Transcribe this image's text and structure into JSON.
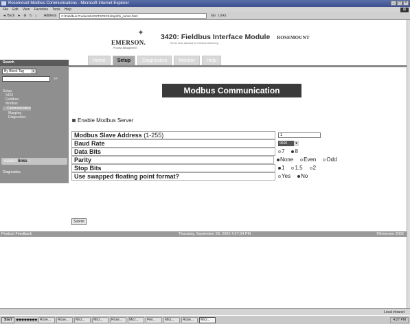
{
  "window": {
    "title": "Rosemount Modbus Communications - Microsoft Internet Explorer",
    "menus": [
      "File",
      "Edit",
      "View",
      "Favorites",
      "Tools",
      "Help"
    ]
  },
  "toolbar": {
    "back": "Back",
    "address_label": "Address",
    "address": "C:\\Fieldbus Products\\HOSTSPEC\\Hlmp\\fcb_comm.html",
    "go": "Go",
    "links": "Links"
  },
  "header": {
    "logo_text": "EMERSON.",
    "logo_sub": "Process Management",
    "app_title": "3420: Fieldbus Interface Module",
    "app_subtitle": "The Air facto standard for Fieldbus Monitoring",
    "brand": "ROSEMOUNT"
  },
  "tabs": [
    {
      "label": "Home"
    },
    {
      "label": "Setup",
      "active": true
    },
    {
      "label": "Diagnostics"
    },
    {
      "label": "Monitor"
    },
    {
      "label": "Help"
    }
  ],
  "sidebar": {
    "search_label": "Search",
    "search_type": "By Block Tag",
    "go": ">>",
    "nav": {
      "setup": "Setup",
      "model": "3420",
      "fieldbus": "Fieldbus",
      "modbus": "Modbus",
      "communication": "Communication",
      "mapping": "Mapping",
      "diagnostics": "Diagnostics"
    },
    "related_prefix": "related",
    "related_links": "links",
    "diagnostics_link": "Diagnostics"
  },
  "main": {
    "title": "Modbus Communication",
    "enable_label": "Enable Modbus Server",
    "enable_checked": true,
    "slave_address_label": "Modbus Slave Address",
    "slave_address_range": "(1-255)",
    "slave_address_value": "1",
    "baud_rate_label": "Baud Rate",
    "baud_rate_value": "9600",
    "data_bits_label": "Data Bits",
    "data_bits_options": [
      "7",
      "8"
    ],
    "data_bits_selected": "8",
    "parity_label": "Parity",
    "parity_options": [
      "None",
      "Even",
      "Odd"
    ],
    "parity_selected": "None",
    "stop_bits_label": "Stop Bits",
    "stop_bits_options": [
      "1",
      "1.5",
      "2"
    ],
    "stop_bits_selected": "1",
    "swapped_label": "Use swapped floating point format?",
    "swapped_options": [
      "Yes",
      "No"
    ],
    "swapped_selected": "No",
    "submit_label": "Submit"
  },
  "footer": {
    "left": "Product Feedback",
    "middle": "Thursday, September 26, 2002 4:27:34 PM",
    "right": "©Emerson 2002"
  },
  "status": {
    "zone": "Local intranet"
  },
  "taskbar": {
    "start": "Start",
    "tasks": [
      "Rose...",
      "Rose...",
      "Micr...",
      "Micr...",
      "Rose...",
      "Micr...",
      "Fiel...",
      "Micr...",
      "Rose...",
      "Micr..."
    ],
    "clock": "4:27 PM"
  }
}
